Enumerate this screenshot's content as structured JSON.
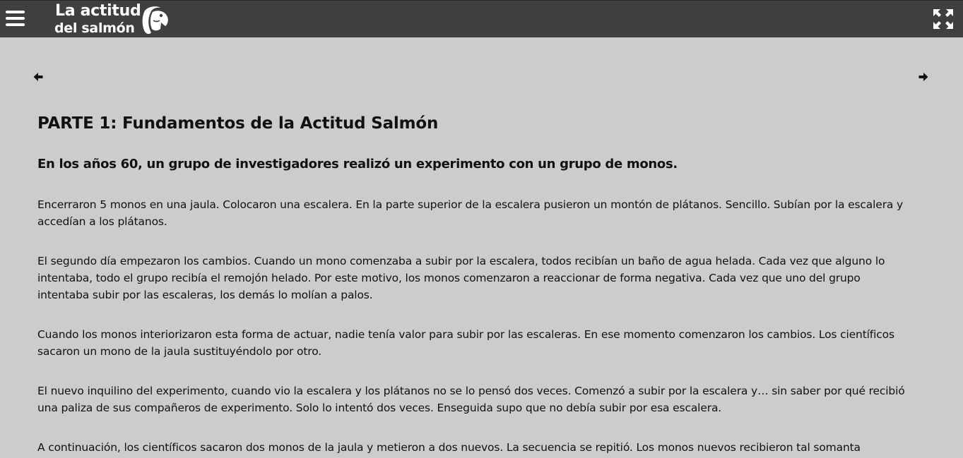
{
  "header": {
    "logo_line1": "La actitud",
    "logo_line2": "del salmón",
    "menu_icon": "hamburger-menu-icon",
    "logo_icon": "salmon-fish-icon",
    "fullscreen_icon": "expand-arrows-icon",
    "background": "#3f3f3f"
  },
  "navigation": {
    "prev_icon": "arrow-left-icon",
    "next_icon": "arrow-right-icon"
  },
  "article": {
    "title": "PARTE 1: Fundamentos de la Actitud Salmón",
    "subtitle": "En los años 60, un grupo de investigadores realizó un experimento con un grupo de monos.",
    "paragraphs": [
      "Encerraron 5 monos en una jaula. Colocaron una escalera. En la parte superior de la escalera pusieron un montón de plátanos. Sencillo. Subían por la escalera y accedían a los plátanos.",
      "El segundo día empezaron los cambios. Cuando un mono comenzaba a subir por la escalera, todos recibían un baño de agua helada. Cada vez que alguno lo intentaba, todo el grupo recibía el remojón helado. Por este motivo, los monos comenzaron a reaccionar de forma negativa. Cada vez que uno del grupo intentaba subir por las escaleras, los demás lo molían a palos.",
      "Cuando los monos interiorizaron esta forma de actuar, nadie tenía valor para subir por las escaleras. En ese momento comenzaron los cambios. Los científicos sacaron un mono de la jaula sustituyéndolo por otro.",
      "El nuevo inquilino del experimento, cuando vio la escalera y los plátanos no se lo pensó dos veces. Comenzó a subir por la escalera y… sin saber por qué recibió una paliza de sus compañeros de experimento. Solo lo intentó dos veces. Enseguida supo que no debía subir por esa escalera.",
      "A continuación, los científicos sacaron dos monos de la jaula y metieron a dos nuevos. La secuencia se repitió. Los monos nuevos recibieron tal somanta"
    ]
  },
  "colors": {
    "page_background": "#cccccc",
    "text": "#111111",
    "header_text": "#ffffff"
  }
}
